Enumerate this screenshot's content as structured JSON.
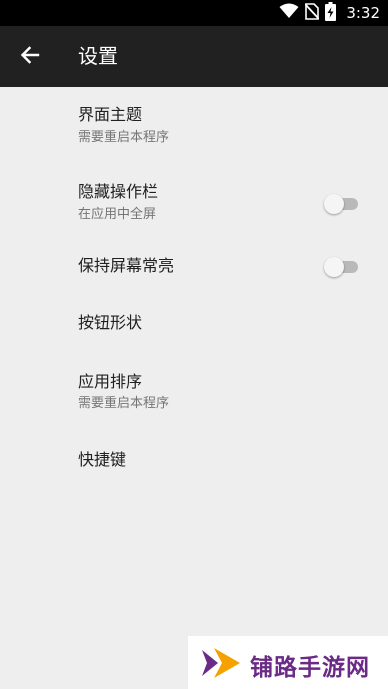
{
  "status_bar": {
    "time": "3:32",
    "icons": [
      "wifi-icon",
      "no-sim-icon",
      "battery-charging-icon"
    ]
  },
  "app_bar": {
    "back_icon": "arrow-left-icon",
    "title": "设置"
  },
  "settings": {
    "theme": {
      "title": "界面主题",
      "subtitle": "需要重启本程序"
    },
    "hide_action_bar": {
      "title": "隐藏操作栏",
      "subtitle": "在应用中全屏",
      "toggle_on": false
    },
    "keep_screen_on": {
      "title": "保持屏幕常亮",
      "toggle_on": false
    },
    "button_shape": {
      "title": "按钮形状"
    },
    "app_sort": {
      "title": "应用排序",
      "subtitle": "需要重启本程序"
    },
    "shortcuts": {
      "title": "快捷键"
    }
  },
  "watermark": {
    "text": "铺路手游网",
    "color": "#6a2a86",
    "accent": "#f5a200"
  },
  "colors": {
    "status_bar": "#000000",
    "app_bar": "#212121",
    "background": "#eeeeee",
    "primary_text": "#212121",
    "secondary_text": "#757575"
  }
}
